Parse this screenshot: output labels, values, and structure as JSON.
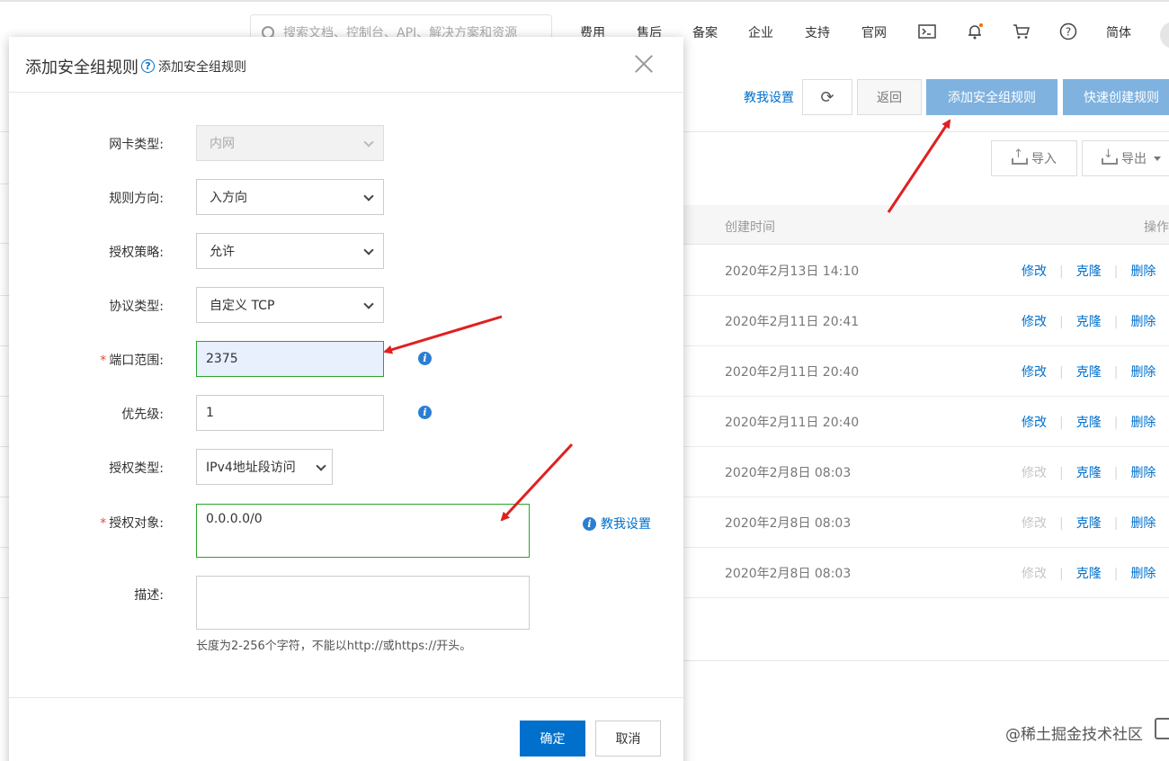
{
  "topbar": {
    "search_placeholder": "搜索文档、控制台、API、解决方案和资源",
    "nav": [
      "费用",
      "售后",
      "备案",
      "企业",
      "支持",
      "官网"
    ],
    "lang": "简体",
    "icons": [
      "terminal-icon",
      "bell-icon",
      "cart-icon",
      "help-icon"
    ]
  },
  "console": {
    "teach_link": "教我设置",
    "back": "返回",
    "add_rule": "添加安全组规则",
    "quick_create": "快速创建规则",
    "import": "导入",
    "export": "导出",
    "table": {
      "col_created": "创建时间",
      "col_ops": "操作",
      "rows": [
        {
          "time": "2020年2月13日 14:10",
          "edit_disabled": false
        },
        {
          "time": "2020年2月11日 20:41",
          "edit_disabled": false
        },
        {
          "time": "2020年2月11日 20:40",
          "edit_disabled": false
        },
        {
          "time": "2020年2月11日 20:40",
          "edit_disabled": false
        },
        {
          "time": "2020年2月8日 08:03",
          "edit_disabled": true
        },
        {
          "time": "2020年2月8日 08:03",
          "edit_disabled": true
        },
        {
          "time": "2020年2月8日 08:03",
          "edit_disabled": true
        }
      ],
      "actions": {
        "edit": "修改",
        "clone": "克隆",
        "delete": "删除",
        "sep": "|"
      }
    },
    "watermark": "@稀土掘金技术社区"
  },
  "modal": {
    "title": "添加安全组规则",
    "help_icon_glyph": "?",
    "help_text": "添加安全组规则",
    "fields": {
      "nic_type": {
        "label": "网卡类型:",
        "value": "内网"
      },
      "direction": {
        "label": "规则方向:",
        "value": "入方向"
      },
      "policy": {
        "label": "授权策略:",
        "value": "允许"
      },
      "protocol": {
        "label": "协议类型:",
        "value": "自定义 TCP"
      },
      "port_range": {
        "label": "端口范围:",
        "required": "*",
        "value": "2375"
      },
      "priority": {
        "label": "优先级:",
        "value": "1"
      },
      "auth_type": {
        "label": "授权类型:",
        "value": "IPv4地址段访问"
      },
      "auth_object": {
        "label": "授权对象:",
        "required": "*",
        "value": "0.0.0.0/0"
      },
      "description": {
        "label": "描述:",
        "value": "",
        "hint": "长度为2-256个字符，不能以http://或https://开头。"
      }
    },
    "info_glyph": "i",
    "teach_link": "教我设置",
    "ok": "确定",
    "cancel": "取消"
  },
  "colors": {
    "primary": "#0070cc",
    "primary_light": "#7fb2df",
    "success_border": "#2aa52a",
    "required": "#e64a3b",
    "annotation_arrow": "#e02020"
  }
}
